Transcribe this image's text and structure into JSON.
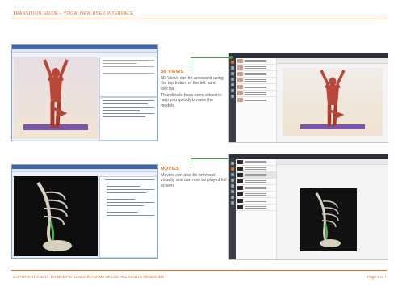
{
  "header": {
    "title": "TRANSITION GUIDE – YOGA: NEW USER INTERFACE"
  },
  "section_3d": {
    "title": "3D VIEWS",
    "body": "3D Views can be accessed using the top button of the left hand tool bar.",
    "body2": "Thumbnails have been added to help you quickly browse the models."
  },
  "section_movies": {
    "title": "MOVIES",
    "body": "Movies can also be browsed visually and can now be played full screen."
  },
  "footer": {
    "copyright": "COPYRIGHT © 2017, PRIMAL PICTURES, INFORMA UK LTD. ALL RIGHTS RESERVED",
    "page": "Page 2 of 7"
  },
  "colors": {
    "accent": "#e36b24",
    "arrow": "#3aa63a"
  }
}
